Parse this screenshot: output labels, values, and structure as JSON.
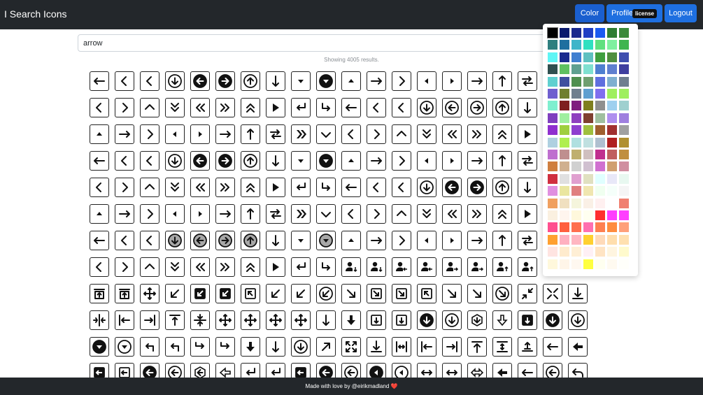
{
  "app": {
    "title": "I Search Icons"
  },
  "nav": {
    "color_label": "Color",
    "profile_label": "Profile",
    "license_badge": "license",
    "logout_label": "Logout"
  },
  "search": {
    "value": "arrow"
  },
  "results": {
    "text": "Showing 4005 results."
  },
  "footer": {
    "text": "Made with love by @eirikmadland",
    "heart": "❤️"
  },
  "icon_rows": [
    [
      "arrow-left",
      "chevron-left",
      "chevron-left",
      "arrow-circle-down",
      "arrow-circle-left-fill",
      "arrow-circle-right-fill",
      "arrow-circle-up",
      "arrow-down",
      "caret-down",
      "caret-down-circle-fill",
      "caret-up",
      "arrow-right",
      "chevron-right",
      "caret-left",
      "caret-right",
      "arrow-right",
      "arrow-up",
      "arrow-left-right"
    ],
    [
      "chevron-left",
      "chevron-right",
      "chevron-up",
      "chevrons-down",
      "chevrons-left",
      "chevrons-right",
      "chevrons-up",
      "play",
      "return-left",
      "return-right",
      "arrow-left",
      "chevron-left",
      "chevron-left",
      "arrow-circle-down",
      "arrow-circle-left",
      "arrow-circle-right",
      "arrow-circle-up",
      "arrow-down"
    ],
    [
      "caret-up",
      "arrow-right",
      "chevron-right",
      "caret-left",
      "caret-right",
      "arrow-right",
      "arrow-up",
      "arrow-left-right",
      "chevrons-right-bold",
      "chevron-down",
      "chevron-left",
      "chevron-right",
      "chevron-up",
      "chevrons-down",
      "chevrons-left",
      "chevrons-right",
      "chevrons-up",
      "play"
    ],
    [
      "arrow-left",
      "chevron-left",
      "chevron-left",
      "arrow-circle-down",
      "arrow-circle-left-fill",
      "arrow-circle-right-fill",
      "arrow-circle-up",
      "arrow-down",
      "caret-down",
      "caret-down-circle-fill",
      "caret-up",
      "arrow-right",
      "chevron-right",
      "caret-left",
      "caret-right",
      "arrow-right",
      "arrow-up",
      "arrow-left-right"
    ],
    [
      "chevron-left",
      "chevron-right",
      "chevron-up",
      "chevrons-down",
      "chevrons-left",
      "chevrons-right",
      "chevrons-up",
      "play",
      "return-left",
      "return-right",
      "arrow-left",
      "chevron-left",
      "chevron-left",
      "arrow-circle-down",
      "arrow-circle-left-fill",
      "arrow-circle-right-fill",
      "arrow-circle-up",
      "arrow-down"
    ],
    [
      "caret-up",
      "arrow-right",
      "chevron-right",
      "caret-left",
      "caret-right",
      "arrow-right",
      "arrow-up",
      "arrow-left-right",
      "chevrons-right-bold",
      "chevron-down",
      "chevron-left",
      "chevron-right",
      "chevron-up",
      "chevrons-down",
      "chevrons-left",
      "chevrons-right",
      "chevrons-up",
      "play"
    ],
    [
      "arrow-left",
      "chevron-left",
      "chevron-left",
      "arrow-circle-down-gray",
      "arrow-circle-left-gray",
      "arrow-circle-right-gray",
      "arrow-circle-up-gray",
      "arrow-down",
      "caret-down",
      "caret-down-circle-gray",
      "caret-up",
      "arrow-right",
      "chevron-right",
      "caret-left",
      "caret-right",
      "arrow-right",
      "arrow-up",
      "arrow-left-right"
    ],
    [
      "chevron-left",
      "chevron-right",
      "chevron-up",
      "chevrons-down",
      "chevrons-left",
      "chevrons-right",
      "chevrons-up",
      "play",
      "return-left",
      "return-right",
      "user-arrow-down",
      "user-arrow-down",
      "user-arrow-left",
      "user-arrow-left",
      "user-arrow-right",
      "user-arrow-right",
      "user-arrow-up",
      "user-arrow-up"
    ],
    [
      "archive-up",
      "archive-up",
      "move",
      "arrow-down-left",
      "box-arrow-down-left",
      "box-arrow-down-left",
      "box-arrow-up-left",
      "arrow-down-left",
      "arrow-down-left",
      "arrow-circle-down-left",
      "arrow-down-right",
      "box-arrow-down-right",
      "box-arrow-down-right",
      "box-arrow-up-left",
      "arrow-down-right",
      "arrow-down-right",
      "arrow-circle-down-right",
      "arrows-collapse-diagonal",
      "arrows-collapse",
      "arrow-to-bottom"
    ],
    [
      "arrows-inward-h",
      "arrow-bar-left",
      "arrow-bar-right",
      "arrow-bar-up",
      "arrows-collapse-v",
      "move",
      "move-text",
      "move-text",
      "move",
      "arrow-down",
      "arrow-down-bold",
      "box-arrow-down",
      "box-arrow-down",
      "arrow-circle-down-fill",
      "arrow-circle-down",
      "hexagon-arrow-down",
      "arrow-down-outline",
      "box-arrow-down-fill",
      "arrow-circle-down-fill",
      "arrow-circle-down"
    ],
    [
      "caret-down-circle-fill",
      "caret-down-circle",
      "arrow-return-up-left",
      "arrow-return-up-left-bold",
      "arrow-return-down-right",
      "arrow-return-down-right-bold",
      "arrow-down-bold",
      "arrow-down",
      "arrow-circle-down",
      "arrow-up-right",
      "arrows-expand",
      "arrow-to-bottom",
      "arrows-h-bar",
      "arrow-bar-left",
      "arrow-bar-right",
      "arrow-to-top",
      "arrows-v-bar",
      "arrow-up-to-bar",
      "arrow-left",
      "arrow-left-bold"
    ],
    [
      "box-arrow-left-fill",
      "box-arrow-left",
      "arrow-circle-left-fill",
      "arrow-circle-left",
      "hexagon-arrow-left",
      "arrow-left-outline",
      "return-left",
      "return-left-bold",
      "box-arrow-left-fill",
      "arrow-circle-left-fill",
      "arrow-circle-left",
      "caret-left-circle-fill",
      "caret-left-circle",
      "arrows-h",
      "arrows-h-bold",
      "arrows-h-outline",
      "arrow-left-bold",
      "arrow-left",
      "arrow-circle-left",
      "arrow-undo"
    ]
  ],
  "palette": {
    "colors": [
      "#000000",
      "#0a1a6e",
      "#1a2a8e",
      "#1f3fc4",
      "#1a5af0",
      "#2e7d32",
      "#3a8a3a",
      "#2f7f7f",
      "#1f6f9f",
      "#3fb5c9",
      "#2fe0c0",
      "#5fe07f",
      "#7ff0a0",
      "#3fb54f",
      "#5ff5f5",
      "#1a2a8e",
      "#3f7fd0",
      "#5fc0c0",
      "#3f9f3f",
      "#4f8f3f",
      "#3f4faf",
      "#2f4f4f",
      "#5fc060",
      "#5fa090",
      "#7fe0d0",
      "#4f7fd0",
      "#5f7fcf",
      "#3f3f9f",
      "#5fd0d0",
      "#3f4f9f",
      "#4f8f4f",
      "#6f9f6f",
      "#5f6fdf",
      "#7fb0d0",
      "#6f7f8f",
      "#6f5fcf",
      "#6f7f2f",
      "#6f7f8f",
      "#5f9fd0",
      "#7f6fef",
      "#9fef5f",
      "#9fef5f",
      "#7fefcf",
      "#7f1f1f",
      "#7f1f7f",
      "#7f7f1f",
      "#8f8f8f",
      "#9fd0ef",
      "#9fd0cf",
      "#7f3fbf",
      "#9fef9f",
      "#8f3fbf",
      "#7f3f2f",
      "#9fbf9f",
      "#af8fef",
      "#9f7fdf",
      "#8f2fcf",
      "#9fcf3f",
      "#8f3fcf",
      "#9fbf3f",
      "#9f5f2f",
      "#a03030",
      "#a0a0a0",
      "#afd0e0",
      "#afef4f",
      "#b0e0e0",
      "#c0e0e0",
      "#b0c0d0",
      "#b02020",
      "#b08f2f",
      "#bf6fcf",
      "#bf8f8f",
      "#bfaf6f",
      "#cfbfbf",
      "#c02f8f",
      "#c05f5f",
      "#c08f3f",
      "#cf7f3f",
      "#d0b08f",
      "#d0d0d0",
      "#d0c0d0",
      "#d070d0",
      "#d0a070",
      "#d08fa0",
      "#d02f3f",
      "#e0e0e0",
      "#e0a0d0",
      "#e0e0c0",
      "#e0ffff",
      "#e8e8f8",
      "#e8f8f0",
      "#e090e0",
      "#eae6a0",
      "#e08080",
      "#f0e6b0",
      "#f0fff0",
      "#f5fffa",
      "#f5f5f5",
      "#f0a060",
      "#f0e0c0",
      "#f5f5dc",
      "#faf0e6",
      "#fff0f0",
      "#ffffff",
      "#f08070",
      "#faf0e0",
      "#fff5ee",
      "#fff8dc",
      "#fffff0",
      "#ff2f2f",
      "#ff3fff",
      "#ff3fff",
      "#ff4f8f",
      "#ff5f3f",
      "#ff6f4f",
      "#ff6fb0",
      "#ff7f50",
      "#ff8c3f",
      "#ffa07a",
      "#ffa030",
      "#ffb0c0",
      "#ffb6c1",
      "#ffd030",
      "#ffdab9",
      "#ffdead",
      "#ffe0b0",
      "#ffe4e1",
      "#ffebcd",
      "#ffefd5",
      "#fff0f5",
      "#ffe4c4",
      "#fff5e0",
      "#fffacd",
      "#fff8dc",
      "#fff5e8",
      "#fff8f0",
      "#ffff3f",
      "#fffff0",
      "#fffaf0",
      "#fffffa"
    ]
  }
}
